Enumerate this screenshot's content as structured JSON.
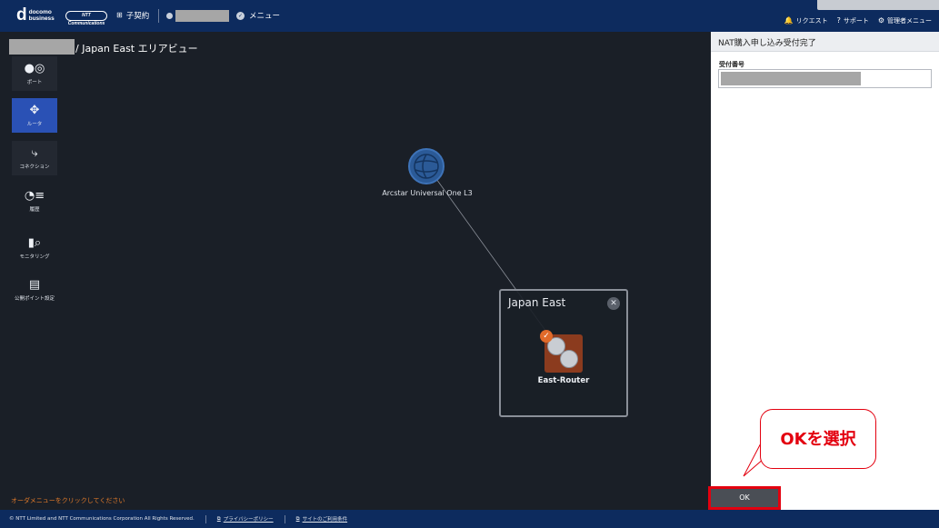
{
  "header": {
    "logo_d": "d",
    "logo_line1": "docomo",
    "logo_line2": "business",
    "ntt_logo": "NTT Communications",
    "contract_label": "子契約",
    "menu_label": "メニュー",
    "right_items": [
      {
        "icon": "bell-icon",
        "label": "リクエスト"
      },
      {
        "icon": "help-icon",
        "label": "サポート"
      },
      {
        "icon": "gear-icon",
        "label": "管理者メニュー"
      }
    ]
  },
  "breadcrumb": {
    "text": "/ Japan East エリアビュー"
  },
  "sidebar": {
    "items": [
      {
        "label": "ポート",
        "icon": "port-icon",
        "glyph": "●◎"
      },
      {
        "label": "ルータ",
        "icon": "router-icon",
        "glyph": "✥"
      },
      {
        "label": "コネクション",
        "icon": "connection-icon",
        "glyph": "⤷"
      },
      {
        "label": "履歴",
        "icon": "history-icon",
        "glyph": "◔≡"
      },
      {
        "label": "モニタリング",
        "icon": "monitoring-icon",
        "glyph": "▮⌕"
      },
      {
        "label": "公開ポイント設定",
        "icon": "public-point-icon",
        "glyph": "▤"
      }
    ]
  },
  "topology": {
    "cloud_node": "Arcstar Universal One L3",
    "region_title": "Japan East",
    "router_name": "East-Router"
  },
  "hint": "オーダメニューをクリックしてください",
  "panel": {
    "title": "NAT購入申し込み受付完了",
    "receipt_label": "受付番号",
    "ok_label": "OK"
  },
  "callout": {
    "text": "OKを選択"
  },
  "footer": {
    "copyright": "© NTT Limited and NTT Communications Corporation All Rights Reserved.",
    "privacy": "プライバシーポリシー",
    "terms": "サイトのご利用条件"
  },
  "colors": {
    "header_bg": "#0d2b5e",
    "canvas_bg": "#1a1f27",
    "active_side": "#2a51b5",
    "router_bg": "#8b3b1e",
    "accent_orange": "#e06a2a",
    "callout_red": "#e3000f"
  }
}
